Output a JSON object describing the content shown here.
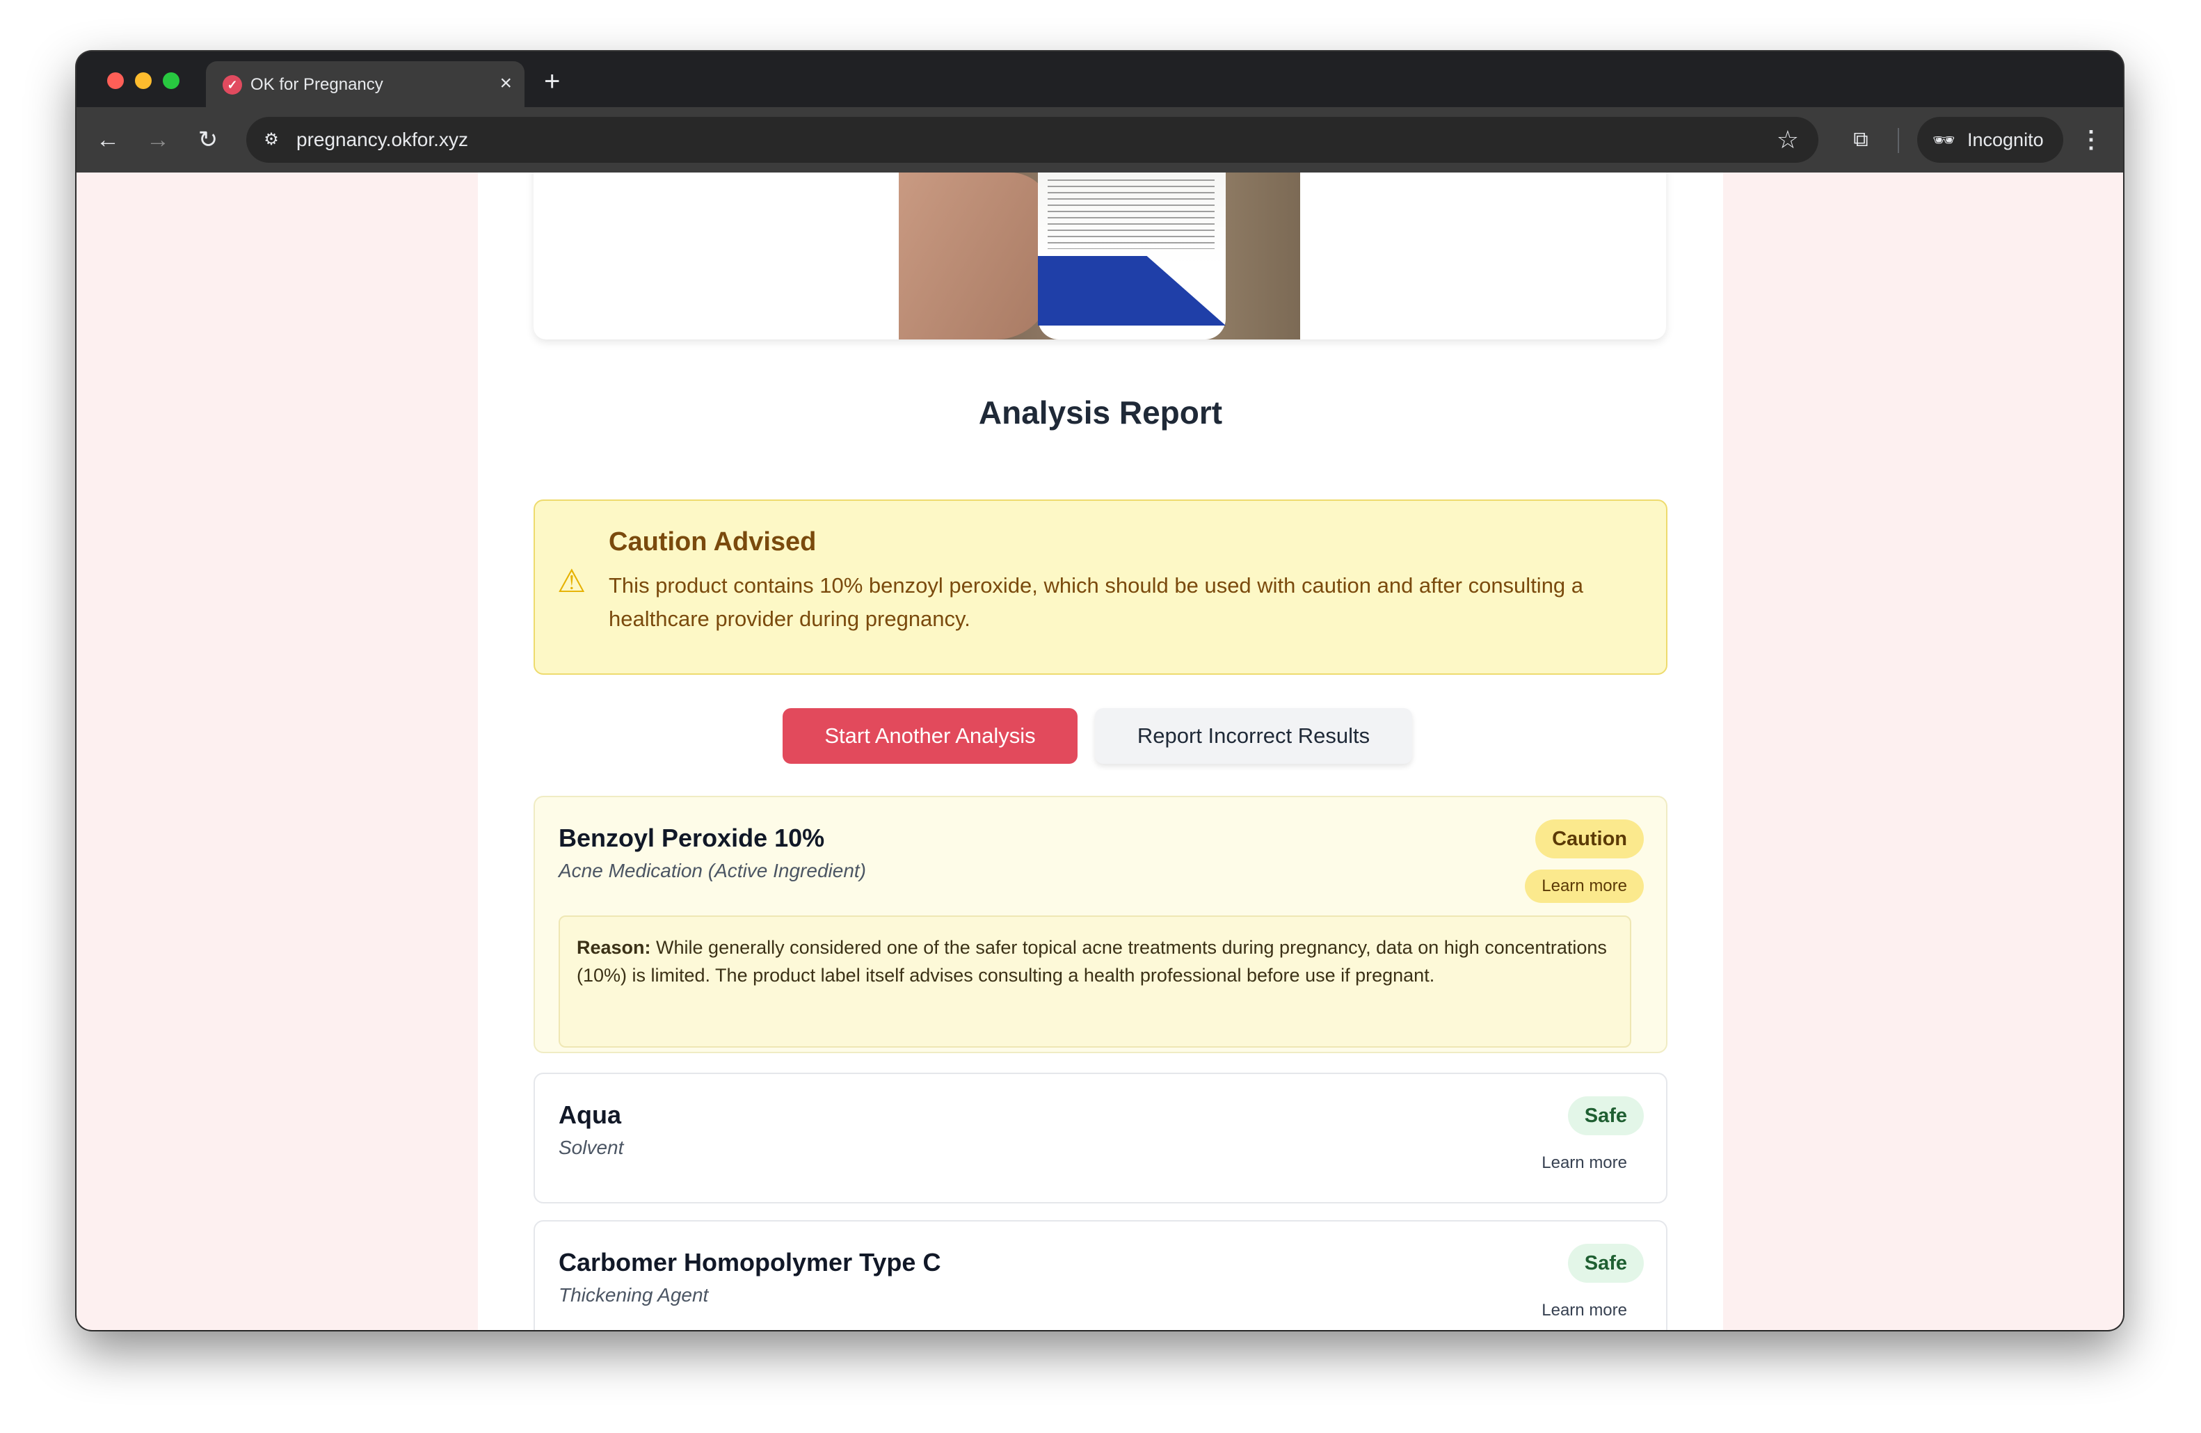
{
  "browser": {
    "tab_title": "OK for Pregnancy",
    "new_tab": "+",
    "tab_close": "×",
    "url": "pregnancy.okfor.xyz",
    "incognito_label": "Incognito"
  },
  "report": {
    "title": "Analysis Report",
    "alert": {
      "title": "Caution Advised",
      "text": "This product contains 10% benzoyl peroxide, which should be used with caution and after consulting a healthcare provider during pregnancy.",
      "icon": "warning-icon"
    },
    "buttons": {
      "primary": "Start Another Analysis",
      "secondary": "Report Incorrect Results"
    },
    "ingredients": [
      {
        "name": "Benzoyl Peroxide 10%",
        "role": "Acne Medication (Active Ingredient)",
        "status": "Caution",
        "learn_more": "Learn more",
        "reason_label": "Reason:",
        "reason": "While generally considered one of the safer topical acne treatments during pregnancy, data on high concentrations (10%) is limited. The product label itself advises consulting a health professional before use if pregnant."
      },
      {
        "name": "Aqua",
        "role": "Solvent",
        "status": "Safe",
        "learn_more": "Learn more"
      },
      {
        "name": "Carbomer Homopolymer Type C",
        "role": "Thickening Agent",
        "status": "Safe",
        "learn_more": "Learn more"
      }
    ]
  },
  "colors": {
    "accent": "#e24a5c",
    "caution": "#fbe98d",
    "safe": "#e3f6e8",
    "page_bg": "#fdf0f0"
  }
}
